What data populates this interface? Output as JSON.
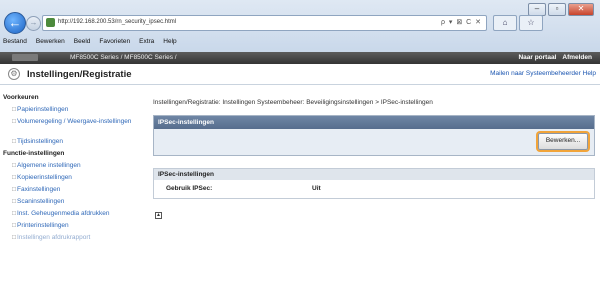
{
  "browser": {
    "url": "http://192.168.200.53/rn_security_ipsec.html",
    "address_tools": "ρ ▾ ⊠ C ✕",
    "window_controls": [
      "–",
      "▫",
      "✕"
    ],
    "tab_buttons": [
      "⌂",
      "☆"
    ],
    "menu": [
      "Bestand",
      "Bewerken",
      "Beeld",
      "Favorieten",
      "Extra",
      "Help"
    ]
  },
  "device_bar": {
    "title": "MF8500C Series / MF8500C Series /",
    "links": [
      "Naar portaal",
      "Afmelden"
    ]
  },
  "title_bar": {
    "heading": "Instellingen/Registratie",
    "top_links": "Mailen naar Systeembeheerder  Help"
  },
  "sidebar": {
    "groups": [
      {
        "label": "Voorkeuren",
        "items": [
          "Papierinstellingen",
          "Volumeregeling / Weergave-instellingen",
          "Tijdsinstellingen"
        ]
      },
      {
        "label": "Functie-instellingen",
        "items": [
          "Algemene instellingen",
          "Kopieerinstellingen",
          "Faxinstellingen",
          "Scaninstellingen",
          "Inst. Geheugenmedia afdrukken",
          "Printerinstellingen",
          "Instellingen afdrukrapport"
        ]
      }
    ]
  },
  "main": {
    "breadcrumb": "Instellingen/Registratie: Instellingen Systeembeheer: Beveiligingsinstellingen > IPSec-instellingen",
    "panel_title": "IPSec-instellingen",
    "edit_button": "Bewerken...",
    "section_title": "IPSec-instellingen",
    "rows": [
      {
        "label": "Gebruik IPSec:",
        "value": "Uit"
      }
    ]
  },
  "colors": {
    "accent_highlight": "#f1a43a",
    "panel_header": "#6f86a5",
    "link": "#2f68b8"
  }
}
